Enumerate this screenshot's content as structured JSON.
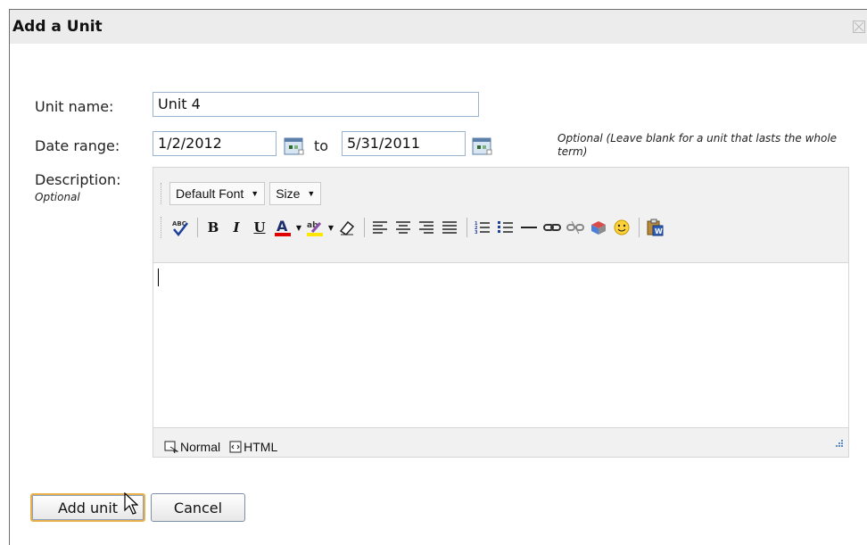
{
  "dialog": {
    "title": "Add a Unit"
  },
  "form": {
    "unit_name_label": "Unit name:",
    "unit_name_value": "Unit 4",
    "date_range_label": "Date range:",
    "start_date": "1/2/2012",
    "to_label": "to",
    "end_date": "5/31/2011",
    "date_note": "Optional (Leave blank for a unit that lasts the whole term)",
    "description_label": "Description:",
    "description_optional": "Optional"
  },
  "editor": {
    "font_dropdown": "Default Font",
    "size_dropdown": "Size",
    "mode_normal": "Normal",
    "mode_html": "HTML",
    "toolbar_icons": [
      "spellcheck-icon",
      "bold-icon",
      "italic-icon",
      "underline-icon",
      "font-color-icon",
      "highlight-icon",
      "eraser-icon",
      "align-left-icon",
      "align-center-icon",
      "align-right-icon",
      "justify-icon",
      "ordered-list-icon",
      "unordered-list-icon",
      "horizontal-rule-icon",
      "link-icon",
      "unlink-icon",
      "insert-image-icon",
      "emoticon-icon",
      "paste-from-word-icon"
    ],
    "font_color": "#e00000",
    "highlight_color": "#ffe600"
  },
  "buttons": {
    "add_unit": "Add unit",
    "cancel": "Cancel"
  },
  "colors": {
    "titlebar_bg": "#ececec",
    "input_border": "#9ab3d1",
    "primary_focus": "#e7b04a"
  }
}
